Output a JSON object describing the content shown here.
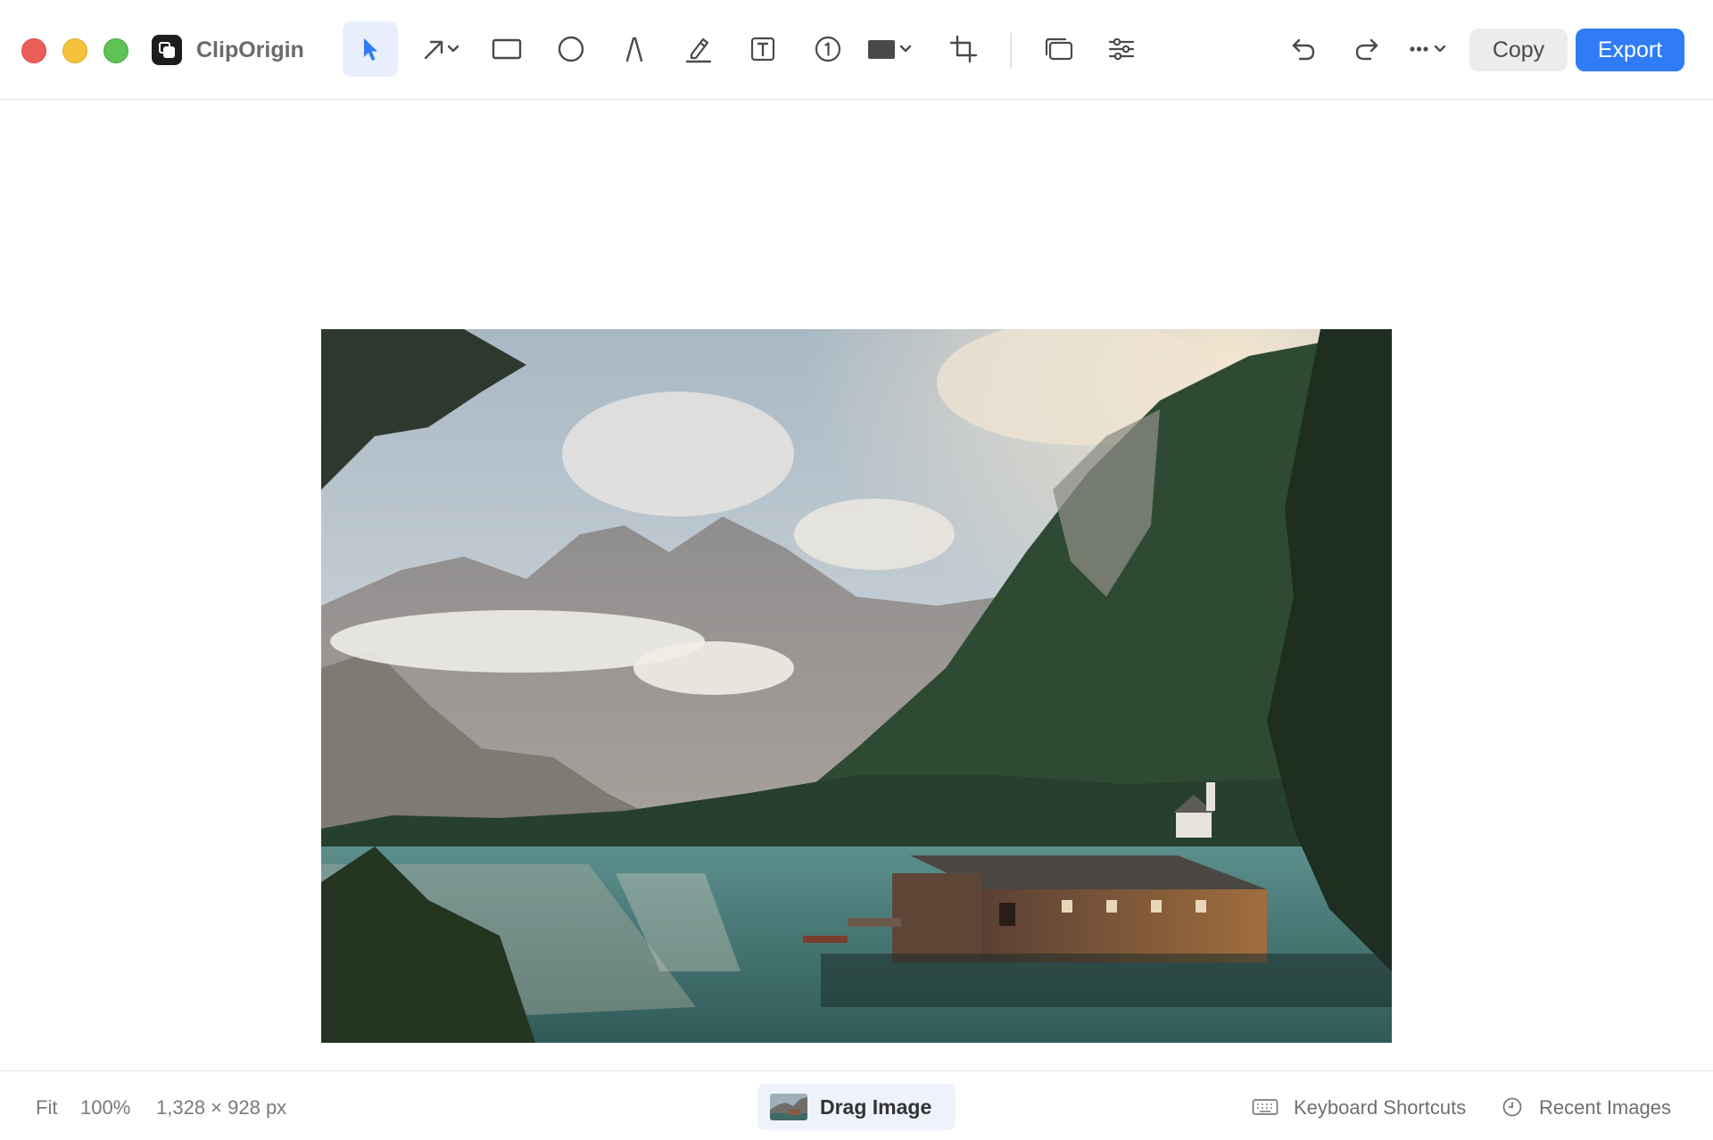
{
  "app": {
    "name": "ClipOrigin"
  },
  "toolbar": {
    "tools": [
      {
        "id": "select",
        "icon": "cursor-arrow-icon",
        "active": true
      },
      {
        "id": "arrow",
        "icon": "arrow-icon",
        "dropdown": true
      },
      {
        "id": "rectangle",
        "icon": "rectangle-icon"
      },
      {
        "id": "ellipse",
        "icon": "circle-icon"
      },
      {
        "id": "pen",
        "icon": "pen-nib-icon"
      },
      {
        "id": "highlighter",
        "icon": "highlighter-icon"
      },
      {
        "id": "text",
        "icon": "text-box-icon"
      },
      {
        "id": "counter",
        "icon": "numbered-counter-icon",
        "counter_label": "1"
      },
      {
        "id": "fill",
        "icon": "fill-color-icon",
        "dropdown": true
      },
      {
        "id": "crop",
        "icon": "crop-icon"
      },
      {
        "id": "background",
        "icon": "stacked-windows-icon"
      },
      {
        "id": "adjust",
        "icon": "sliders-icon"
      }
    ],
    "undo_icon": "undo-icon",
    "redo_icon": "redo-icon",
    "more_icon": "more-options-icon",
    "copy_label": "Copy",
    "export_label": "Export",
    "accent_color": "#2f7cf6"
  },
  "status": {
    "fit_label": "Fit",
    "zoom": "100%",
    "dimensions": "1,328 × 928 px",
    "drag_label": "Drag Image",
    "shortcuts_label": "Keyboard Shortcuts",
    "recent_label": "Recent Images"
  }
}
